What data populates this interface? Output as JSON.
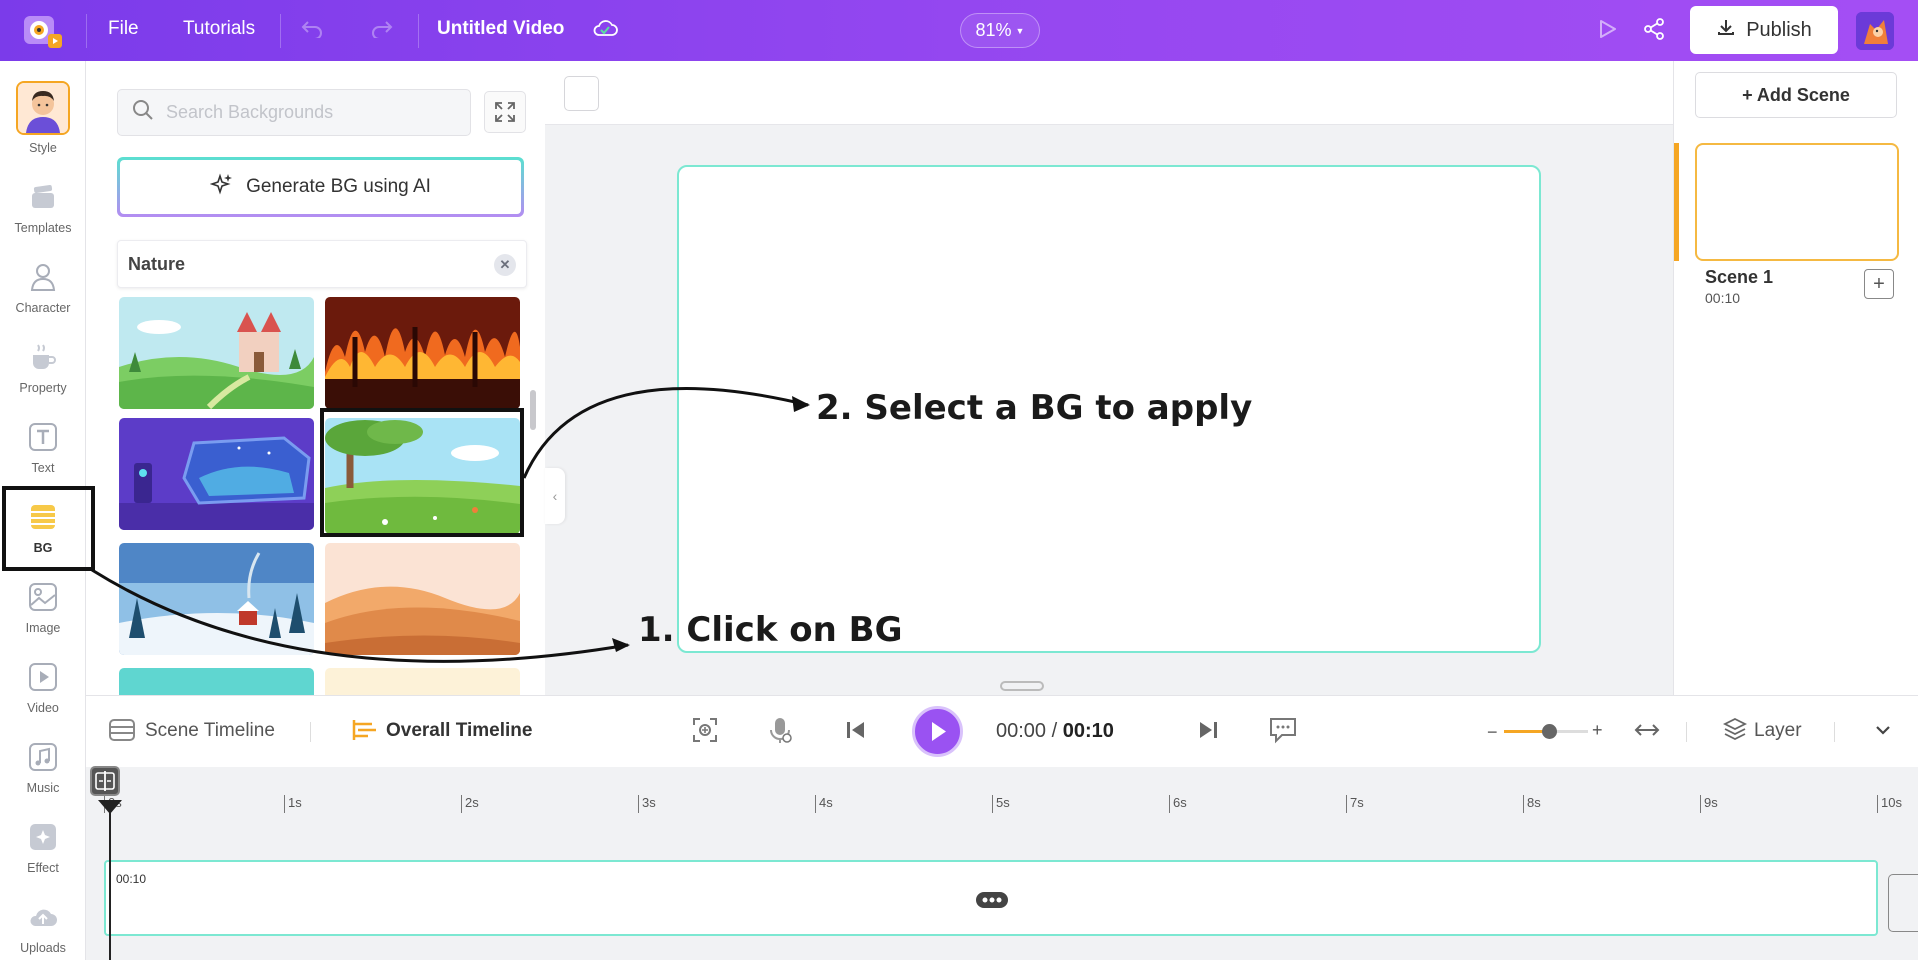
{
  "topbar": {
    "file_label": "File",
    "tutorials_label": "Tutorials",
    "project_title": "Untitled Video",
    "zoom_level": "81%",
    "publish_label": "Publish"
  },
  "nav": {
    "items": [
      {
        "label": "Style",
        "icon": "style-avatar-icon"
      },
      {
        "label": "Templates",
        "icon": "templates-icon"
      },
      {
        "label": "Character",
        "icon": "character-icon"
      },
      {
        "label": "Property",
        "icon": "property-icon"
      },
      {
        "label": "Text",
        "icon": "text-icon"
      },
      {
        "label": "BG",
        "icon": "bg-layers-icon"
      },
      {
        "label": "Image",
        "icon": "image-icon"
      },
      {
        "label": "Video",
        "icon": "video-icon"
      },
      {
        "label": "Music",
        "icon": "music-icon"
      },
      {
        "label": "Effect",
        "icon": "effect-icon"
      },
      {
        "label": "Uploads",
        "icon": "uploads-icon"
      }
    ],
    "active": "BG"
  },
  "panel": {
    "search_placeholder": "Search Backgrounds",
    "generate_label": "Generate BG using AI",
    "filter_label": "Nature"
  },
  "scenes": {
    "add_label": "+ Add Scene",
    "items": [
      {
        "name": "Scene 1",
        "duration": "00:10"
      }
    ]
  },
  "timeline": {
    "scene_timeline_label": "Scene Timeline",
    "overall_timeline_label": "Overall Timeline",
    "current_time": "00:00",
    "separator": "/",
    "total_time": "00:10",
    "layer_label": "Layer",
    "ruler_ticks": [
      "0s",
      "1s",
      "2s",
      "3s",
      "4s",
      "5s",
      "6s",
      "7s",
      "8s",
      "9s",
      "10s"
    ],
    "track_duration": "00:10"
  },
  "annotations": {
    "step1": "1. Click on BG",
    "step2": "2. Select a BG to apply"
  },
  "colors": {
    "accent": "#9a52f2",
    "stage_border": "#7ce8d2",
    "scene_selected": "#f5b942"
  }
}
